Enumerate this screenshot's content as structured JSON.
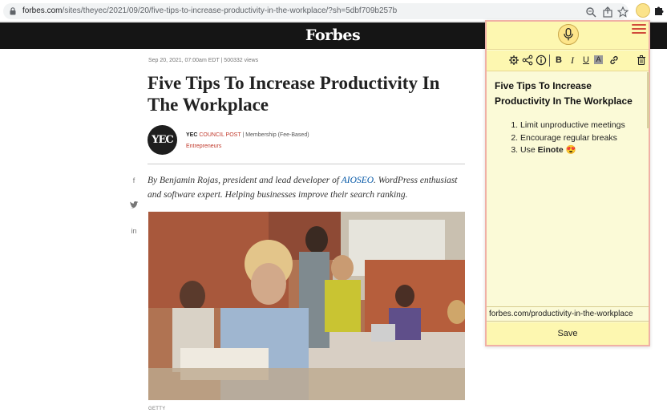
{
  "browser": {
    "url_host": "forbes.com",
    "url_path": "/sites/theyec/2021/09/20/five-tips-to-increase-productivity-in-the-workplace/?sh=5dbf709b257b",
    "icons": [
      "lock-icon",
      "zoom-icon",
      "share-icon",
      "star-icon",
      "einote-extension-icon",
      "extensions-puzzle-icon"
    ]
  },
  "site": {
    "logo": "Forbes"
  },
  "article": {
    "meta": "Sep 20, 2021, 07:00am EDT  |  500332 views",
    "headline": "Five Tips To Increase Productivity In The Workplace",
    "avatar_text": "YEC",
    "author_name": "YEC",
    "author_council": "COUNCIL POST",
    "author_membership": " | Membership (Fee-Based)",
    "author_category": "Entrepreneurs",
    "byline_pre": "By Benjamin Rojas, president and lead developer of ",
    "byline_link": "AIOSEO",
    "byline_post": ". WordPress enthusiast and software expert. Helping businesses improve their search ranking.",
    "social": {
      "facebook": "f",
      "twitter": "❧",
      "linkedin": "in"
    },
    "image_caption": "GETTY"
  },
  "extension": {
    "note_title": "Five Tips To Increase Productivity In The Workplace",
    "items": [
      "Limit unproductive meetings",
      "Encourage regular breaks"
    ],
    "item3_prefix": "Use ",
    "item3_bold": "Einote",
    "item3_emoji": "😍",
    "url_value": "forbes.com/productivity-in-the-workplace",
    "save_label": "Save",
    "toolbar": {
      "bold": "B",
      "italic": "I",
      "underline": "U",
      "highlight": "A"
    },
    "colors": {
      "panel_bg": "#fbfad7",
      "toolbar_bg": "#fdf7b0",
      "border": "#f0b0a6",
      "menu": "#d04a3a"
    }
  }
}
